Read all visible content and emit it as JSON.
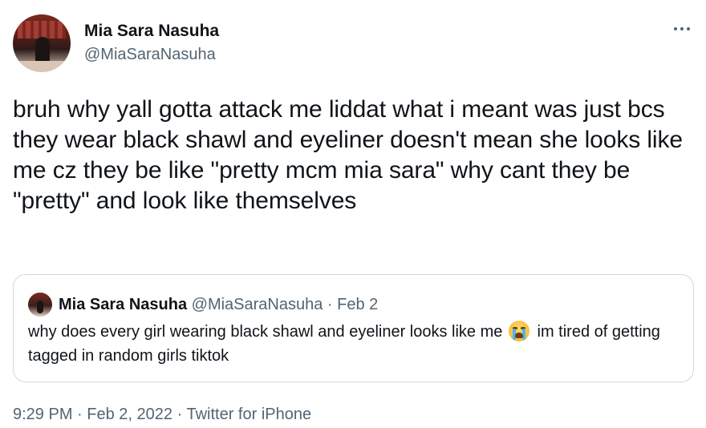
{
  "tweet": {
    "author_name": "Mia Sara Nasuha",
    "author_handle": "@MiaSaraNasuha",
    "more_icon": "more-horizontal-icon",
    "text": "bruh why yall gotta attack me liddat what i meant was just bcs they wear black shawl and eyeliner doesn't mean she looks like me cz they be like \"pretty mcm mia sara\" why cant they be \"pretty\" and look like themselves",
    "quoted": {
      "author_name": "Mia Sara Nasuha",
      "author_handle": "@MiaSaraNasuha",
      "separator": "·",
      "date": "Feb 2",
      "text_before_emoji": "why does every girl wearing black shawl and eyeliner looks like me",
      "emoji": "loudly-crying-face-emoji",
      "text_after_emoji": "im tired of getting tagged in random girls tiktok"
    },
    "time": "9:29 PM",
    "date": "Feb 2, 2022",
    "source": "Twitter for iPhone",
    "meta_separator": "·"
  },
  "colors": {
    "text_primary": "#0f1419",
    "text_secondary": "#536471",
    "border": "#cfd9de"
  }
}
